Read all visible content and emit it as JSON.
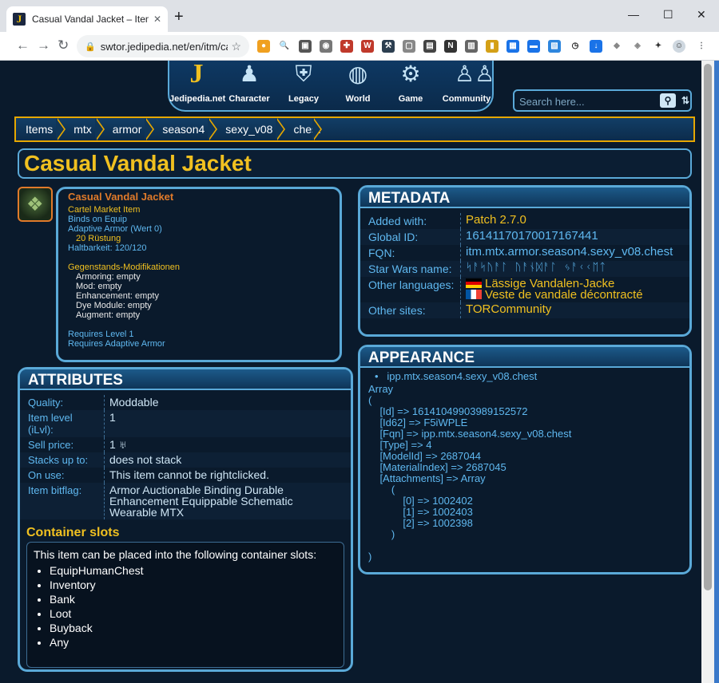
{
  "browser": {
    "tab_title": "Casual Vandal Jacket – Items – Jedipedia",
    "url": "swtor.jedipedia.net/en/itm/ca..."
  },
  "nav": {
    "items": [
      {
        "label": "Jedipedia.net",
        "icon": "jedipedia-logo-icon"
      },
      {
        "label": "Character",
        "icon": "character-icon"
      },
      {
        "label": "Legacy",
        "icon": "legacy-icon"
      },
      {
        "label": "World",
        "icon": "world-icon"
      },
      {
        "label": "Game",
        "icon": "game-icon"
      },
      {
        "label": "Community",
        "icon": "community-icon"
      }
    ],
    "search_placeholder": "Search here..."
  },
  "breadcrumb": [
    "Items",
    "mtx",
    "armor",
    "season4",
    "sexy_v08",
    "chest"
  ],
  "page_title": "Casual Vandal Jacket",
  "tooltip": {
    "name": "Casual Vandal Jacket",
    "cartel": "Cartel Market Item",
    "binds": "Binds on Equip",
    "armor_type": "Adaptive Armor (Wert 0)",
    "armor_value": "20 Rüstung",
    "durability": "Haltbarkeit: 120/120",
    "mods_header": "Gegenstands-Modifikationen",
    "mods": [
      "Armoring: empty",
      "Mod: empty",
      "Enhancement: empty",
      "Dye Module: empty",
      "Augment: empty"
    ],
    "req_level": "Requires Level 1",
    "req_armor": "Requires Adaptive Armor"
  },
  "metadata": {
    "heading": "METADATA",
    "rows": [
      {
        "k": "Added with:",
        "v": "Patch 2.7.0"
      },
      {
        "k": "Global ID:",
        "v": "16141170170017167441"
      },
      {
        "k": "FQN:",
        "v": "itm.mtx.armor.season4.sexy_v08.chest"
      },
      {
        "k": "Star Wars name:",
        "v": "ᛋᚨᛋᚢᚨᛚ ᚢᚨᚾᛞᚨᛚ ᛃᚨᚲᚲᛖᛏ"
      },
      {
        "k": "Other languages:",
        "de": "Lässige Vandalen-Jacke",
        "fr": "Veste de vandale décontracté"
      },
      {
        "k": "Other sites:",
        "v": "TORCommunity"
      }
    ]
  },
  "attributes": {
    "heading": "ATTRIBUTES",
    "rows": [
      {
        "k": "Quality:",
        "v": "Moddable"
      },
      {
        "k": "Item level (iLvl):",
        "v": "1"
      },
      {
        "k": "Sell price:",
        "v": "1 ♅"
      },
      {
        "k": "Stacks up to:",
        "v": "does not stack"
      },
      {
        "k": "On use:",
        "v": "This item cannot be rightclicked."
      },
      {
        "k": "Item bitflag:",
        "v": "Armor Auctionable Binding Durable Enhancement Equippable Schematic Wearable MTX"
      }
    ],
    "container_title": "Container slots",
    "container_text": "This item can be placed into the following container slots:",
    "container_slots": [
      "EquipHumanChest",
      "Inventory",
      "Bank",
      "Loot",
      "Buyback",
      "Any"
    ]
  },
  "appearance": {
    "heading": "APPEARANCE",
    "bullet": "ipp.mtx.season4.sexy_v08.chest",
    "dump": "Array\n(\n    [Id] => 16141049903989152572\n    [Id62] => F5iWPLE\n    [Fqn] => ipp.mtx.season4.sexy_v08.chest\n    [Type] => 4\n    [ModelId] => 2687044\n    [MaterialIndex] => 2687045\n    [Attachments] => Array\n        (\n            [0] => 1002402\n            [1] => 1002403\n            [2] => 1002398\n        )\n\n)"
  }
}
